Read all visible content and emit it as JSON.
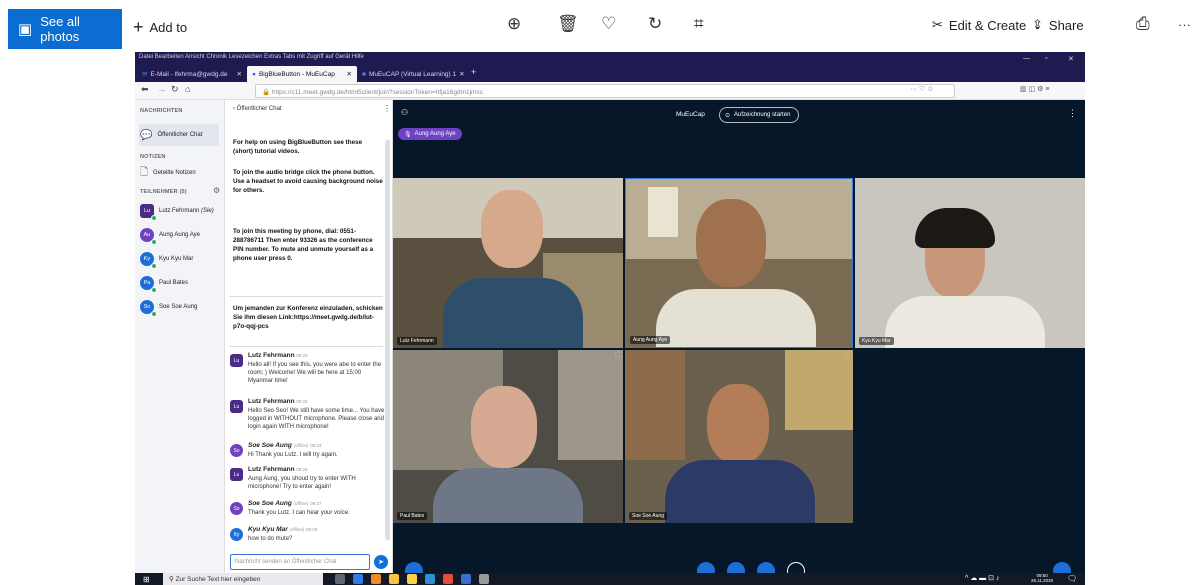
{
  "photos_bar": {
    "see_all_label": "See all photos",
    "add_to_label": "Add to",
    "edit_create_label": "Edit & Create",
    "share_label": "Share",
    "more_label": "···"
  },
  "browser": {
    "menubar": "Datei  Bearbeiten  Ansicht  Chronik  Lesezeichen  Extras  Tabs mit Zugriff auf Gerät  Hilfe",
    "tabs": [
      {
        "label": "E-Mail - lfehrma@gwdg.de"
      },
      {
        "label": "BigBlueButton - MuEuCap"
      },
      {
        "label": "MuEuCAP (Virtual Learning) 1"
      }
    ],
    "url": "https://c11.meet.gwdg.de/html5client/join?sessionToken=hfja16gdm1jmxc"
  },
  "userlist": {
    "messages_heading": "NACHRICHTEN",
    "public_chat_label": "Öffentlicher Chat",
    "notes_heading": "NOTIZEN",
    "shared_notes_label": "Geteilte Notizen",
    "participants_heading": "TEILNEHMER (5)",
    "users": [
      {
        "initials": "Lu",
        "name": "Lutz Fehrmann",
        "suffix": "(Sie)",
        "color": "#4a2c86"
      },
      {
        "initials": "Au",
        "name": "Aung Aung Aye",
        "suffix": "",
        "color": "#6f42c1"
      },
      {
        "initials": "Ky",
        "name": "Kyu Kyu Mar",
        "suffix": "",
        "color": "#1e6ed8"
      },
      {
        "initials": "Pa",
        "name": "Paul Bates",
        "suffix": "",
        "color": "#1e6ed8"
      },
      {
        "initials": "So",
        "name": "Soe Soe Aung",
        "suffix": "",
        "color": "#1e6ed8"
      }
    ]
  },
  "chat": {
    "title": "Öffentlicher Chat",
    "welcome_1": "For help on using BigBlueButton see these (short) tutorial videos.",
    "welcome_2": "To join the audio bridge click the phone button. Use a headset to avoid causing background noise for others.",
    "welcome_3": "To join this meeting by phone, dial: 0551-288786711 Then enter 93326 as the conference PIN number. To mute and unmute yourself as a phone user press 0.",
    "invite": "Um jemanden zur Konferenz einzuladen, schicken Sie ihm diesen Link:https://meet.gwdg.de/b/lut-p7o-qqj-pcs",
    "messages": [
      {
        "initials": "Lu",
        "color": "#4a2c86",
        "name": "Lutz Fehrmann",
        "status": "",
        "time": "09:20",
        "text": "Hello all! If you see this, you were abe to enter the room; ) Welcome! We will be here at 15:00 Myanmar time!"
      },
      {
        "initials": "Lu",
        "color": "#4a2c86",
        "name": "Lutz Fehrmann",
        "status": "",
        "time": "09:22",
        "text": "Hello Seo Seo! We still have some time... You have logged in WITHOUT microphone. Please close and login again WITH microphone!"
      },
      {
        "initials": "So",
        "color": "#6f42c1",
        "name": "Soe Soe Aung",
        "status": "(offline)",
        "time": "09:23",
        "text": "Hi Thank you Lutz. I will try again."
      },
      {
        "initials": "Lu",
        "color": "#4a2c86",
        "name": "Lutz Fehrmann",
        "status": "",
        "time": "09:26",
        "text": "Aung Aung, you shoud try to enter WITH microphone! Try to enter again!"
      },
      {
        "initials": "So",
        "color": "#6f42c1",
        "name": "Soe Soe Aung",
        "status": "(offline)",
        "time": "09:27",
        "text": "Thank you Lutz. I can hear your voice."
      },
      {
        "initials": "Ky",
        "color": "#1e6ed8",
        "name": "Kyu Kyu Mar",
        "status": "(offline)",
        "time": "09:28",
        "text": "how to do mute?"
      }
    ],
    "input_placeholder": "Nachricht senden an Öffentlicher Chat"
  },
  "meeting": {
    "room_name": "MuEuCap",
    "record_label": "Aufzeichnung starten",
    "talker": "Aung Aung Aye",
    "tiles": [
      {
        "label": "Lutz Fehrmann",
        "bg": "#5a5040"
      },
      {
        "label": "Aung Aung Aye",
        "bg": "#7a6a52"
      },
      {
        "label": "Kyu Kyu Mar",
        "bg": "#c9c6c0"
      },
      {
        "label": "Paul Bates",
        "bg": "#4f4b45"
      },
      {
        "label": "Soe Soe Aung",
        "bg": "#6b5f4e"
      }
    ]
  },
  "taskbar": {
    "search_placeholder": "Zur Suche Text hier eingeben",
    "time": "09:50",
    "date": "26.11.2020"
  }
}
